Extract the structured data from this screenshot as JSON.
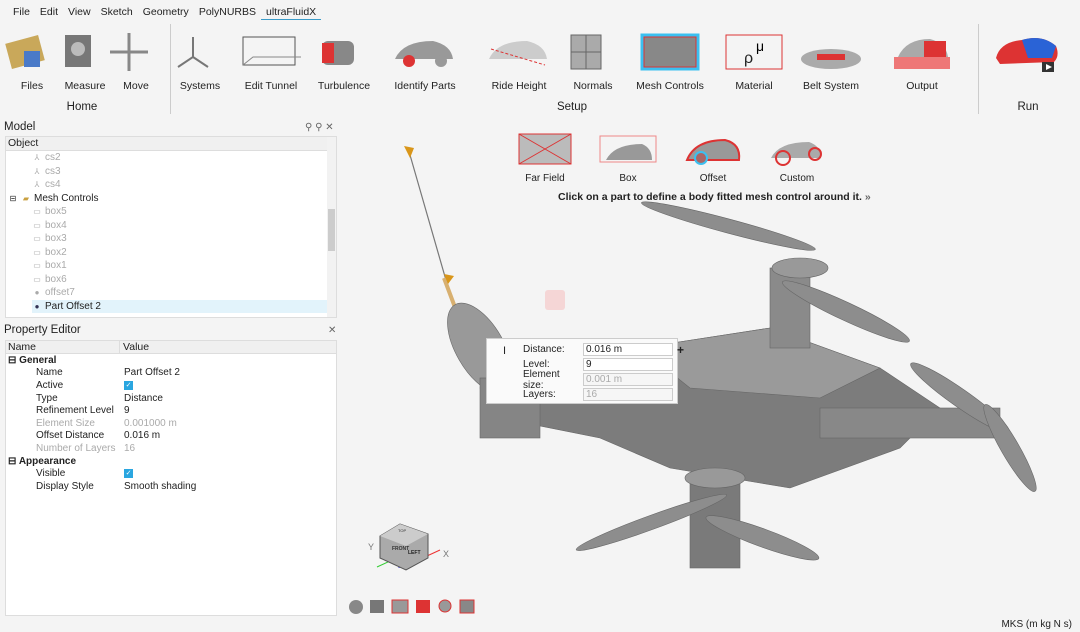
{
  "menu": [
    "File",
    "Edit",
    "View",
    "Sketch",
    "Geometry",
    "PolyNURBS",
    "ultraFluidX"
  ],
  "ribbon": {
    "groups": {
      "home": "Home",
      "setup": "Setup",
      "run": "Run"
    },
    "items": [
      "Files",
      "Measure",
      "Move",
      "Systems",
      "Edit Tunnel",
      "Turbulence",
      "Identify Parts",
      "Ride Height",
      "Normals",
      "Mesh Controls",
      "Material",
      "Belt System",
      "Output"
    ],
    "active": "Mesh Controls"
  },
  "model": {
    "title": "Model",
    "column": "Object",
    "rows": [
      {
        "label": "cs2",
        "icon": "axis-icon",
        "dim": true,
        "indent": 2
      },
      {
        "label": "cs3",
        "icon": "axis-icon",
        "dim": true,
        "indent": 2
      },
      {
        "label": "cs4",
        "icon": "axis-icon",
        "dim": true,
        "indent": 2
      },
      {
        "label": "Mesh Controls",
        "icon": "folder-icon",
        "dim": false,
        "indent": 0
      },
      {
        "label": "box5",
        "icon": "box-icon",
        "dim": true,
        "indent": 2
      },
      {
        "label": "box4",
        "icon": "box-icon",
        "dim": true,
        "indent": 2
      },
      {
        "label": "box3",
        "icon": "box-icon",
        "dim": true,
        "indent": 2
      },
      {
        "label": "box2",
        "icon": "box-icon",
        "dim": true,
        "indent": 2
      },
      {
        "label": "box1",
        "icon": "box-icon",
        "dim": true,
        "indent": 2
      },
      {
        "label": "box6",
        "icon": "box-icon",
        "dim": true,
        "indent": 2
      },
      {
        "label": "offset7",
        "icon": "offset-icon",
        "dim": true,
        "indent": 2
      },
      {
        "label": "Part Offset 2",
        "icon": "offset-icon",
        "dim": false,
        "indent": 2,
        "selected": true
      }
    ]
  },
  "property_editor": {
    "title": "Property Editor",
    "col_name": "Name",
    "col_value": "Value",
    "sections": [
      {
        "title": "General",
        "rows": [
          {
            "name": "Name",
            "value": "Part Offset 2"
          },
          {
            "name": "Active",
            "value": "checked"
          },
          {
            "name": "Type",
            "value": "Distance"
          },
          {
            "name": "Refinement Level",
            "value": "9"
          },
          {
            "name": "Element Size",
            "value": "0.001000 m",
            "dim": true
          },
          {
            "name": "Offset Distance",
            "value": "0.016 m"
          },
          {
            "name": "Number of Layers",
            "value": "16",
            "dim": true
          }
        ]
      },
      {
        "title": "Appearance",
        "rows": [
          {
            "name": "Visible",
            "value": "checked"
          },
          {
            "name": "Display Style",
            "value": "Smooth shading"
          }
        ]
      }
    ]
  },
  "mesh_options": [
    "Far Field",
    "Box",
    "Offset",
    "Custom"
  ],
  "hint": "Click on a part to define a body fitted mesh control around it.",
  "dialog": {
    "distance_label": "Distance:",
    "distance": "0.016 m",
    "level_label": "Level:",
    "level": "9",
    "element_size_label": "Element size:",
    "element_size": "0.001 m",
    "layers_label": "Layers:",
    "layers": "16"
  },
  "axes": {
    "x": "X",
    "y": "Y",
    "cube_front": "FRONT",
    "cube_left": "LEFT",
    "cube_top": "TOP"
  },
  "status": "MKS (m kg N s)",
  "colors": {
    "accent": "#3a9bc8",
    "highlight": "#e2f3fb",
    "checkbox": "#2aa6e0",
    "mesh_red": "#e03030"
  }
}
